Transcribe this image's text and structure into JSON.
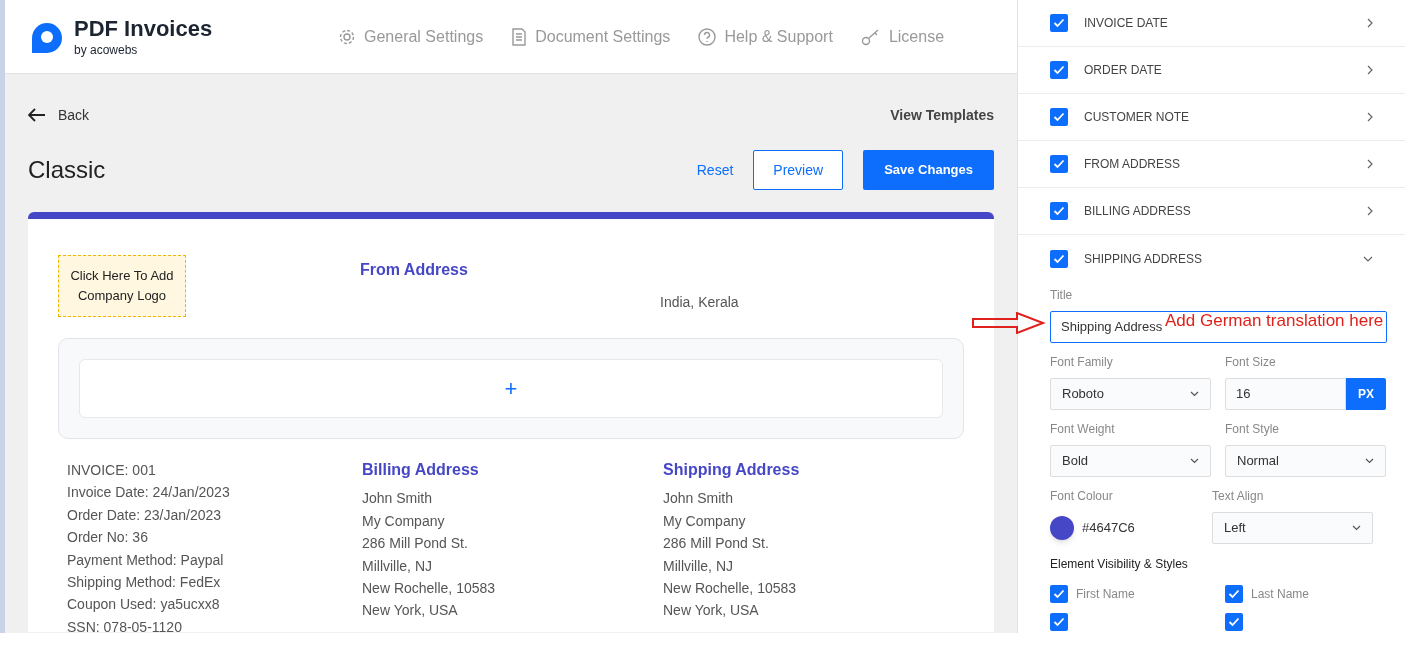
{
  "app": {
    "name": "PDF Invoices",
    "byline": "by acowebs"
  },
  "nav": [
    {
      "label": "General Settings",
      "kind": "gear"
    },
    {
      "label": "Document Settings",
      "kind": "document"
    },
    {
      "label": "Help & Support",
      "kind": "help"
    },
    {
      "label": "License",
      "kind": "key"
    }
  ],
  "toolbar": {
    "back": "Back",
    "view_templates": "View Templates",
    "title": "Classic",
    "reset": "Reset",
    "preview": "Preview",
    "save": "Save Changes"
  },
  "invoice": {
    "logo_placeholder": "Click Here To Add Company Logo",
    "from_title": "From Address",
    "from_line": "India, Kerala",
    "add_button": "+",
    "details": [
      "INVOICE: 001",
      "Invoice Date: 24/Jan/2023",
      "Order Date: 23/Jan/2023",
      "Order No: 36",
      "Payment Method: Paypal",
      "Shipping Method: FedEx",
      "Coupon Used: ya5ucxx8",
      "SSN: 078-05-1120"
    ],
    "addresses": [
      {
        "title": "Billing Address",
        "lines": [
          "John Smith",
          "My Company",
          "286 Mill Pond St.",
          "Millville, NJ",
          "New Rochelle, 10583",
          "New York, USA"
        ]
      },
      {
        "title": "Shipping Address",
        "lines": [
          "John Smith",
          "My Company",
          "286 Mill Pond St.",
          "Millville, NJ",
          "New Rochelle, 10583",
          "New York, USA"
        ]
      }
    ]
  },
  "panel": {
    "sections": [
      {
        "label": "INVOICE DATE",
        "checked": true,
        "expanded": false
      },
      {
        "label": "ORDER DATE",
        "checked": true,
        "expanded": false
      },
      {
        "label": "CUSTOMER NOTE",
        "checked": true,
        "expanded": false
      },
      {
        "label": "FROM ADDRESS",
        "checked": true,
        "expanded": false
      },
      {
        "label": "BILLING ADDRESS",
        "checked": true,
        "expanded": false
      },
      {
        "label": "SHIPPING ADDRESS",
        "checked": true,
        "expanded": true
      }
    ],
    "title": {
      "label": "Title",
      "value": "Shipping Address"
    },
    "font_family": {
      "label": "Font Family",
      "value": "Roboto"
    },
    "font_size": {
      "label": "Font Size",
      "value": "16",
      "unit": "PX"
    },
    "font_weight": {
      "label": "Font Weight",
      "value": "Bold"
    },
    "font_style": {
      "label": "Font Style",
      "value": "Normal"
    },
    "font_colour": {
      "label": "Font Colour",
      "value": "#4647C6",
      "color": "#4647c6"
    },
    "text_align": {
      "label": "Text Align",
      "value": "Left"
    },
    "visibility_title": "Element Visibility & Styles",
    "visibility": [
      {
        "label": "First Name",
        "checked": true
      },
      {
        "label": "Last Name",
        "checked": true
      },
      {
        "checked": true
      },
      {
        "checked": true
      }
    ]
  },
  "annotation": {
    "text": "Add German translation here"
  }
}
